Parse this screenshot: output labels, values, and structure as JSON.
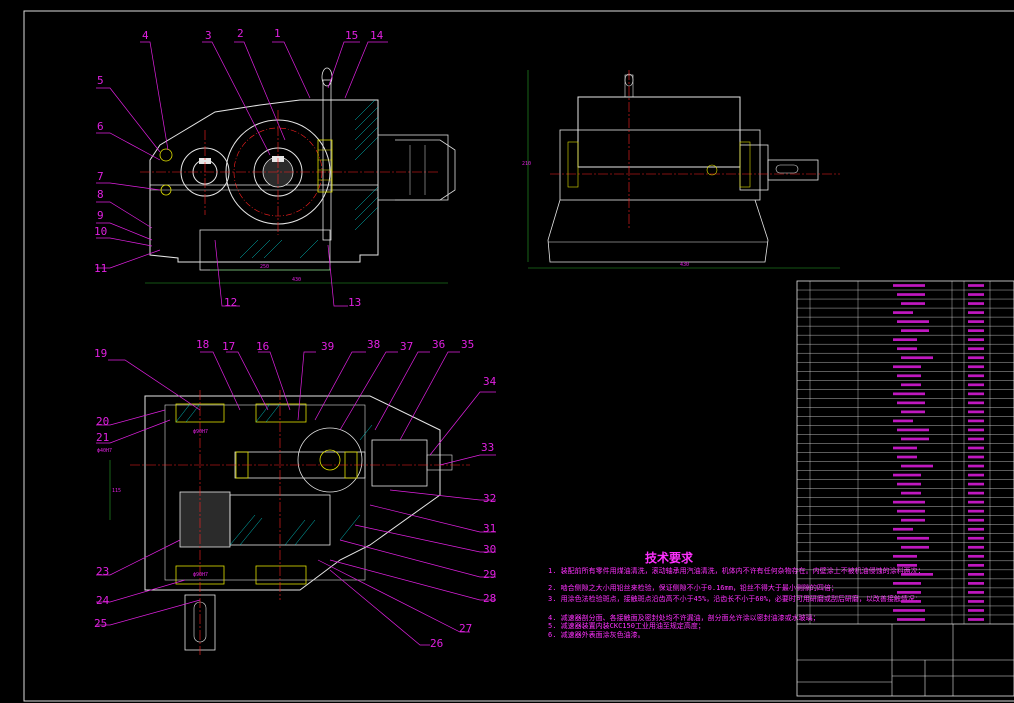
{
  "callouts": {
    "front": [
      "1",
      "2",
      "3",
      "4",
      "5",
      "6",
      "7",
      "8",
      "9",
      "10",
      "11",
      "12",
      "13",
      "14",
      "15"
    ],
    "top": [
      "16",
      "17",
      "18",
      "19",
      "20",
      "21",
      "23",
      "24",
      "25",
      "26",
      "27",
      "28",
      "29",
      "30",
      "31",
      "32",
      "33",
      "34",
      "35",
      "36",
      "37",
      "38",
      "39"
    ]
  },
  "dimensions": {
    "front_width": "430",
    "front_inner": "250",
    "side_width": "430",
    "side_height": "210",
    "top_a": "ϕ90H7",
    "top_b": "ϕ90H7",
    "top_c": "115",
    "top_left": "ϕ40H7"
  },
  "tech_requirements": {
    "title": "技术要求",
    "lines": [
      "1. 装配前所有零件用煤油清洗，滚动轴承用汽油清洗，机体内不许有任何杂物存在。内壁涂上不被机油侵蚀的涂料两次；",
      "2. 啮合侧隙之大小用铅丝来检验，保证侧隙不小于0.16mm，铅丝不得大于最小侧隙的四倍；",
      "3. 用涂色法检验斑点，接触斑点沿齿高不小于45%，沿齿长不小于60%，必要时可用研磨或刮后研磨，以改善接触情况；",
      "4. 减速器剖分面、各接触面及密封处均不许漏油，剖分面允许涂以密封油漆或水玻璃；",
      "5. 减速器装置内装CKC150工业用油至规定高度；",
      "6. 减速器外表面涂灰色油漆。"
    ]
  },
  "colors": {
    "background": "#000000",
    "outline": "#e0e0e0",
    "callout": "#e020e0",
    "centerline": "#ff2020",
    "dimension": "#2aa52a",
    "hatch": "#00c8c8",
    "bearing": "#e0e000"
  }
}
